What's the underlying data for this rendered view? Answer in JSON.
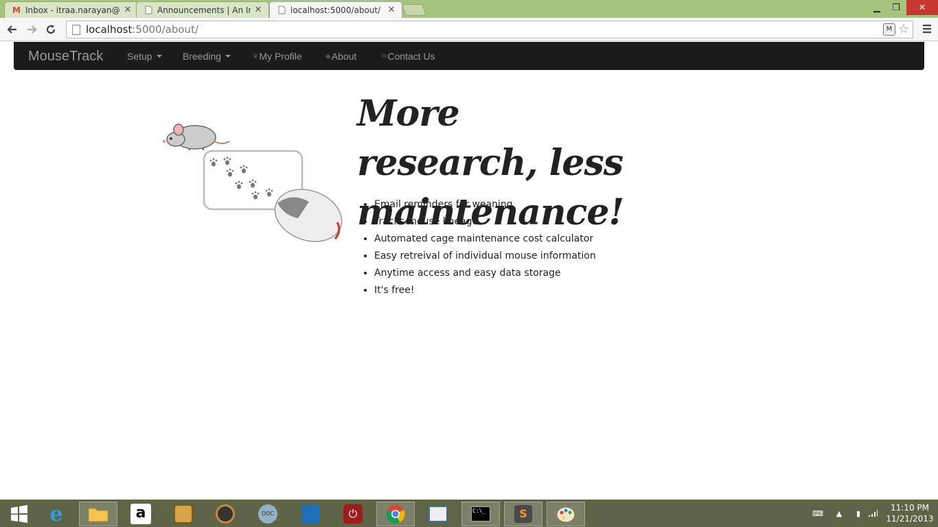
{
  "browser": {
    "tabs": [
      {
        "title": "Inbox - itraa.narayan@gm",
        "icon": "gmail-icon"
      },
      {
        "title": "Announcements | An Intro",
        "icon": "page-icon"
      },
      {
        "title": "localhost:5000/about/",
        "icon": "page-icon"
      }
    ],
    "url_host": "localhost",
    "url_path": ":5000/about/"
  },
  "navbar": {
    "brand": "MouseTrack",
    "items": [
      {
        "label": "Setup",
        "dropdown": true
      },
      {
        "label": "Breeding",
        "dropdown": true
      },
      {
        "label": "My Profile",
        "icon": "leaf-icon"
      },
      {
        "label": "About",
        "icon": "tag-icon"
      },
      {
        "label": "Contact Us",
        "icon": "envelope-icon"
      }
    ]
  },
  "main": {
    "headline": "More research, less maintenance!",
    "features": [
      "Email reminders for weaning",
      "Tracks mouse lineage",
      "Automated cage maintenance cost calculator",
      "Easy retreival of individual mouse information",
      "Anytime access and easy data storage",
      "It's free!"
    ]
  },
  "taskbar": {
    "time": "11:10 PM",
    "date": "11/21/2013"
  },
  "colors": {
    "tabstrip": "#a7c47e",
    "navbar": "#1b1b1b",
    "taskbar": "#5e6546"
  }
}
